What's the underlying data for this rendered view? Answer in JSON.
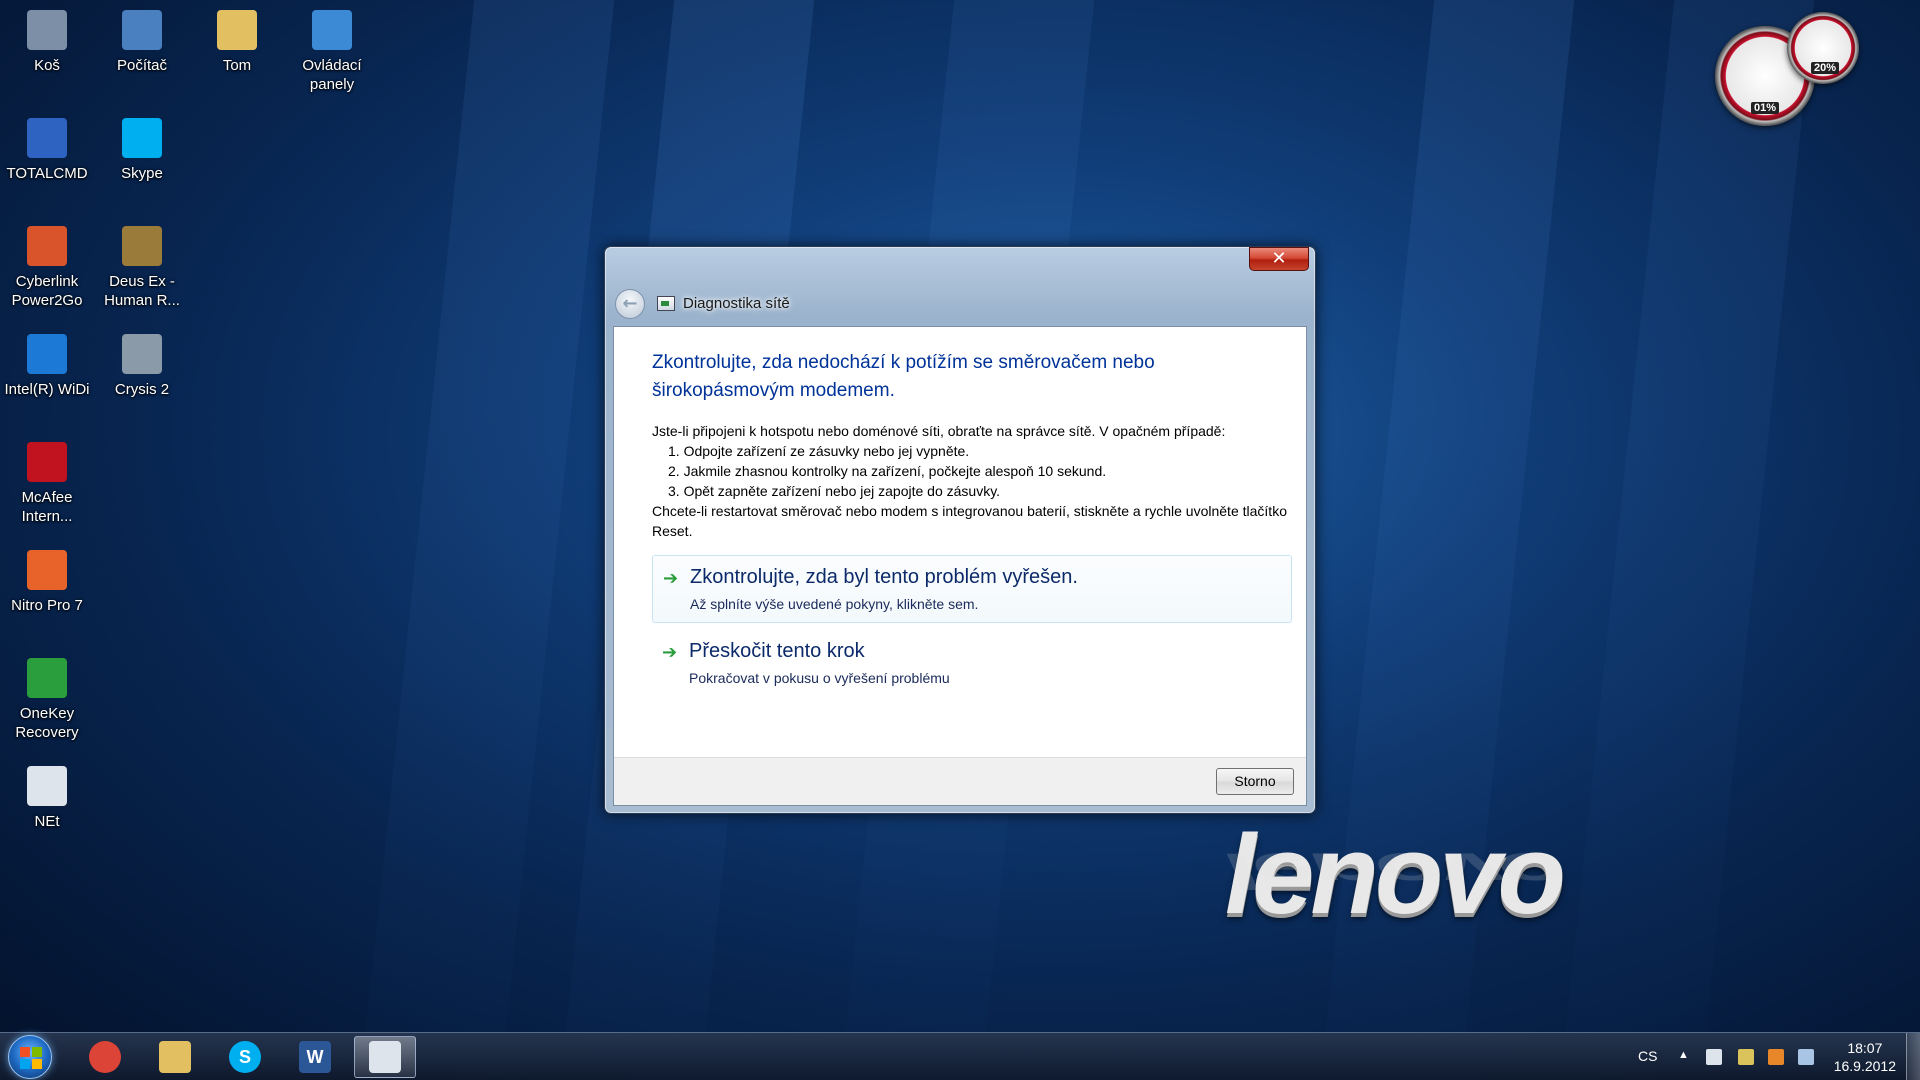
{
  "desktop": {
    "icons": [
      {
        "label": "Koš",
        "icon": "recycle-bin-icon",
        "color": "#7d8fa6"
      },
      {
        "label": "Počítač",
        "icon": "computer-icon",
        "color": "#4a7fc0"
      },
      {
        "label": "Tom",
        "icon": "user-folder-icon",
        "color": "#e2c062"
      },
      {
        "label": "Ovládací panely",
        "icon": "control-panel-icon",
        "color": "#3c8ad6"
      },
      {
        "label": "TOTALCMD",
        "icon": "totalcmd-icon",
        "color": "#2f63c2"
      },
      {
        "label": "Skype",
        "icon": "skype-icon",
        "color": "#00aff0"
      },
      {
        "label": "Cyberlink Power2Go",
        "icon": "power2go-icon",
        "color": "#d9542b"
      },
      {
        "label": "Deus Ex - Human R...",
        "icon": "deus-ex-icon",
        "color": "#9a7b3a"
      },
      {
        "label": "Intel(R) WiDi",
        "icon": "intel-widi-icon",
        "color": "#1c7ad6"
      },
      {
        "label": "Crysis 2",
        "icon": "crysis-icon",
        "color": "#8b9aa8"
      },
      {
        "label": "McAfee Intern...",
        "icon": "mcafee-icon",
        "color": "#c1121f"
      },
      {
        "label": "Nitro Pro 7",
        "icon": "nitro-pro-icon",
        "color": "#e8632a"
      },
      {
        "label": "OneKey Recovery",
        "icon": "onekey-recovery-icon",
        "color": "#2a9d3c"
      },
      {
        "label": "NEt",
        "icon": "network-icon",
        "color": "#dde4ec"
      }
    ]
  },
  "gadget": {
    "cpu_label": "01%",
    "memory_label": "20%"
  },
  "wallpaper": {
    "logo_text": "lenovo"
  },
  "dialog": {
    "close_glyph": "✕",
    "back_glyph": "←",
    "title": "Diagnostika sítě",
    "heading": "Zkontrolujte, zda nedochází k potížím se směrovačem nebo širokopásmovým modemem.",
    "intro": "Jste-li připojeni k hotspotu nebo doménové síti, obraťte na správce sítě. V opačném případě:",
    "steps": [
      "1. Odpojte zařízení ze zásuvky nebo jej vypněte.",
      "2. Jakmile zhasnou kontrolky na zařízení, počkejte alespoň 10 sekund.",
      "3. Opět zapněte zařízení nebo jej zapojte do zásuvky."
    ],
    "note": "Chcete-li restartovat směrovač nebo modem s integrovanou baterií, stiskněte a rychle uvolněte tlačítko Reset.",
    "options": [
      {
        "title": "Zkontrolujte, zda byl tento problém vyřešen.",
        "subtitle": "Až splníte výše uvedené pokyny, klikněte sem."
      },
      {
        "title": "Přeskočit tento krok",
        "subtitle": "Pokračovat v pokusu o vyřešení problému"
      }
    ],
    "cancel_label": "Storno"
  },
  "taskbar": {
    "pinned": [
      {
        "name": "chrome",
        "icon": "chrome-icon",
        "glyph": "",
        "color": "#db4437"
      },
      {
        "name": "explorer",
        "icon": "folder-icon",
        "glyph": "",
        "color": "#e2c062"
      },
      {
        "name": "skype",
        "icon": "skype-icon",
        "glyph": "S",
        "color": "#00aff0"
      },
      {
        "name": "word",
        "icon": "word-icon",
        "glyph": "W",
        "color": "#2b5797"
      },
      {
        "name": "network-diagnostics",
        "icon": "network-diagnostics-icon",
        "glyph": "",
        "color": "#dde4ec"
      }
    ],
    "language": "CS",
    "tray_arrow": "▲",
    "time": "18:07",
    "date": "16.9.2012"
  }
}
